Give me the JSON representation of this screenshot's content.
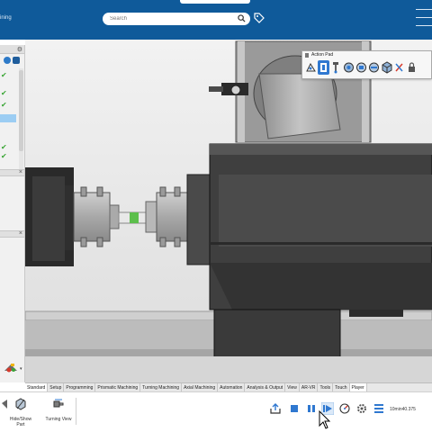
{
  "app": {
    "title_partial": "ining"
  },
  "search": {
    "placeholder": "Search"
  },
  "action_pad": {
    "title": "Action Pad",
    "buttons": [
      "sweep-icon",
      "fixture-icon",
      "probe-icon",
      "view-1-icon",
      "view-2-icon",
      "view-3-icon",
      "cube-icon",
      "transform-icon",
      "lock-icon"
    ]
  },
  "tabs": [
    {
      "label": "Standard",
      "active": true
    },
    {
      "label": "Setup",
      "active": false
    },
    {
      "label": "Programming",
      "active": false
    },
    {
      "label": "Prismatic Machining",
      "active": false
    },
    {
      "label": "Turning Machining",
      "active": false
    },
    {
      "label": "Axial Machining",
      "active": false
    },
    {
      "label": "Automation",
      "active": false
    },
    {
      "label": "Analysis & Output",
      "active": false
    },
    {
      "label": "View",
      "active": false
    },
    {
      "label": "AR-VR",
      "active": false
    },
    {
      "label": "Tools",
      "active": false
    },
    {
      "label": "Touch",
      "active": false
    },
    {
      "label": "Player",
      "active": true
    }
  ],
  "toolbar": {
    "hide_show_label": "Hide/Show Part",
    "turning_view_label": "Turning View",
    "time_readout": "10min40.375"
  },
  "colors": {
    "title_bar": "#0f5a9a",
    "accent": "#2f78d0",
    "check": "#3aa535",
    "selection": "#9ccdf3"
  }
}
